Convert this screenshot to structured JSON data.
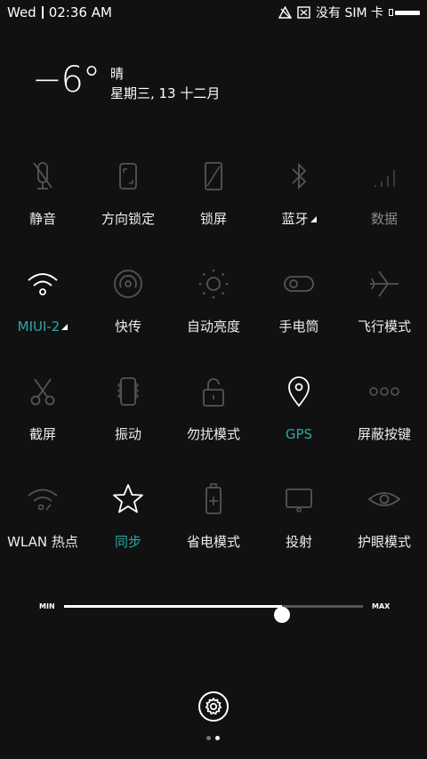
{
  "status_bar": {
    "day": "Wed",
    "time": "02:36  AM",
    "no_sim_text": "没有 SIM 卡"
  },
  "weather": {
    "temperature": "−6°",
    "condition": "晴",
    "date": "星期三, 13 十二月"
  },
  "toggles": [
    {
      "id": "mute",
      "label": "静音",
      "icon": "mute-icon",
      "state": "off"
    },
    {
      "id": "rotation-lock",
      "label": "方向锁定",
      "icon": "rotation-lock-icon",
      "state": "off"
    },
    {
      "id": "lock-screen",
      "label": "锁屏",
      "icon": "lock-screen-icon",
      "state": "off"
    },
    {
      "id": "bluetooth",
      "label": "蓝牙",
      "icon": "bluetooth-icon",
      "state": "off",
      "has_submenu": true
    },
    {
      "id": "mobile-data",
      "label": "数据",
      "icon": "mobile-data-icon",
      "state": "disabled"
    },
    {
      "id": "wifi",
      "label": "MIUI-2",
      "icon": "wifi-icon",
      "state": "on",
      "has_submenu": true
    },
    {
      "id": "quick-share",
      "label": "快传",
      "icon": "quick-share-icon",
      "state": "off"
    },
    {
      "id": "auto-brightness",
      "label": "自动亮度",
      "icon": "auto-brightness-icon",
      "state": "off"
    },
    {
      "id": "flashlight",
      "label": "手电筒",
      "icon": "flashlight-icon",
      "state": "off"
    },
    {
      "id": "airplane",
      "label": "飞行模式",
      "icon": "airplane-icon",
      "state": "off"
    },
    {
      "id": "screenshot",
      "label": "截屏",
      "icon": "scissors-icon",
      "state": "off"
    },
    {
      "id": "vibrate",
      "label": "振动",
      "icon": "vibrate-icon",
      "state": "off"
    },
    {
      "id": "do-not-disturb",
      "label": "勿扰模式",
      "icon": "do-not-disturb-icon",
      "state": "off"
    },
    {
      "id": "gps",
      "label": "GPS",
      "icon": "location-pin-icon",
      "state": "on"
    },
    {
      "id": "hide-buttons",
      "label": "屏蔽按键",
      "icon": "hide-buttons-icon",
      "state": "off"
    },
    {
      "id": "hotspot",
      "label": "WLAN 热点",
      "icon": "hotspot-icon",
      "state": "off"
    },
    {
      "id": "sync",
      "label": "同步",
      "icon": "star-icon",
      "state": "on"
    },
    {
      "id": "battery-saver",
      "label": "省电模式",
      "icon": "battery-saver-icon",
      "state": "off"
    },
    {
      "id": "cast",
      "label": "投射",
      "icon": "cast-icon",
      "state": "off"
    },
    {
      "id": "eye-care",
      "label": "护眼模式",
      "icon": "eye-icon",
      "state": "off"
    }
  ],
  "brightness": {
    "min_label": "MIN",
    "max_label": "MAX",
    "level": 0.73
  },
  "colors": {
    "background": "#111111",
    "active": "#2aa9a3",
    "inactive_icon": "#555555",
    "text": "#ececec"
  },
  "pager": {
    "pages": 2,
    "current": 2
  }
}
